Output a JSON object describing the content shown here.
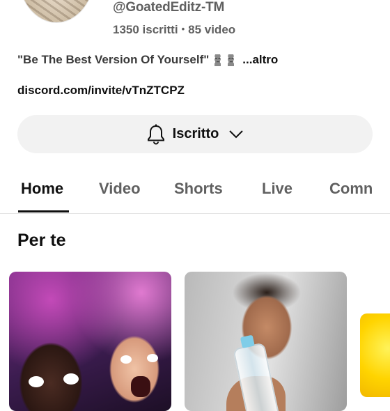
{
  "channel": {
    "handle": "@GoatedEditz-TM",
    "subscribers": "1350 iscritti",
    "stats_separator": "•",
    "videos": "85 video",
    "description": "\"Be The Best Version Of Yourself\"",
    "description_emoji": "moai-icon",
    "more_label": "...altro",
    "link": "discord.com/invite/vTnZTCPZ"
  },
  "subscribe_button": {
    "label": "Iscritto",
    "icon": "bell-icon",
    "dropdown_icon": "chevron-down-icon"
  },
  "tabs": [
    {
      "label": "Home",
      "active": true
    },
    {
      "label": "Video",
      "active": false
    },
    {
      "label": "Shorts",
      "active": false
    },
    {
      "label": "Live",
      "active": false
    },
    {
      "label": "Comn",
      "active": false
    }
  ],
  "section": {
    "title": "Per te"
  },
  "colors": {
    "text_primary": "#0f0f0f",
    "text_secondary": "#606060",
    "button_bg": "#f2f2f2"
  }
}
